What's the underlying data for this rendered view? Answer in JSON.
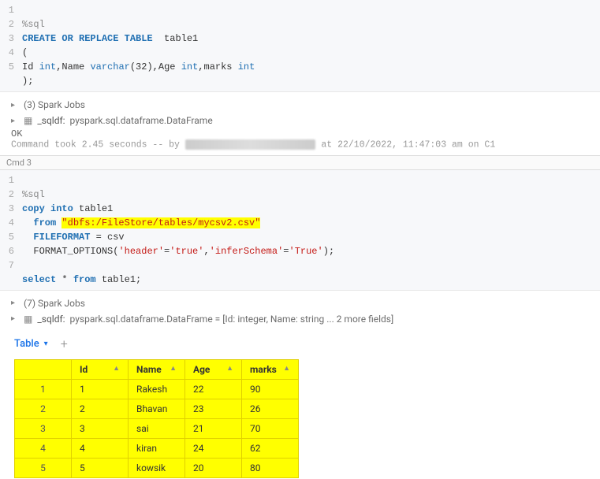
{
  "cell1": {
    "lines": [
      "1",
      "2",
      "3",
      "4",
      "5"
    ],
    "magic": "%sql",
    "t1": "CREATE OR REPLACE TABLE",
    "t1b": "table1",
    "t2": "(",
    "t3_id": "Id",
    "t3_int1": "int",
    "t3_name": ",Name",
    "t3_vc": "varchar",
    "t3_vcn": "(32)",
    "t3_age": ",Age",
    "t3_int2": "int",
    "t3_marks": ",marks",
    "t3_int3": "int",
    "t4": ");"
  },
  "out1": {
    "jobs": "(3) Spark Jobs",
    "sqldf_lbl": "_sqldf:",
    "sqldf_type": "pyspark.sql.dataframe.DataFrame",
    "ok": "OK",
    "meta_pre": "Command took 2.45 seconds -- by ",
    "meta_post": " at 22/10/2022, 11:47:03 am on C1"
  },
  "cmd3": "Cmd 3",
  "cell2": {
    "lines": [
      "1",
      "2",
      "3",
      "4",
      "5",
      "6",
      "7"
    ],
    "magic": "%sql",
    "c1a": "copy into",
    "c1b": "table1",
    "c2a": "from",
    "c2b": "\"dbfs:/FileStore/tables/mycsv2.csv\"",
    "c3a": "FILEFORMAT",
    "c3b": " = csv",
    "c4a": "FORMAT_OPTIONS(",
    "c4b": "'header'",
    "c4c": "=",
    "c4d": "'true'",
    "c4e": ",",
    "c4f": "'inferSchema'",
    "c4g": "=",
    "c4h": "'True'",
    "c4i": ");",
    "c6a": "select",
    "c6b": " * ",
    "c6c": "from",
    "c6d": " table1;"
  },
  "out2": {
    "jobs": "(7) Spark Jobs",
    "sqldf_lbl": "_sqldf:",
    "sqldf_type": "pyspark.sql.dataframe.DataFrame = [Id: integer, Name: string ... 2 more fields]"
  },
  "tabs": {
    "table": "Table"
  },
  "chart_data": {
    "type": "table",
    "columns": [
      "Id",
      "Name",
      "Age",
      "marks"
    ],
    "rows": [
      {
        "rownum": "1",
        "Id": "1",
        "Name": "Rakesh",
        "Age": "22",
        "marks": "90"
      },
      {
        "rownum": "2",
        "Id": "2",
        "Name": "Bhavan",
        "Age": "23",
        "marks": "26"
      },
      {
        "rownum": "3",
        "Id": "3",
        "Name": "sai",
        "Age": "21",
        "marks": "70"
      },
      {
        "rownum": "4",
        "Id": "4",
        "Name": "kiran",
        "Age": "24",
        "marks": "62"
      },
      {
        "rownum": "5",
        "Id": "5",
        "Name": "kowsik",
        "Age": "20",
        "marks": "80"
      }
    ]
  }
}
